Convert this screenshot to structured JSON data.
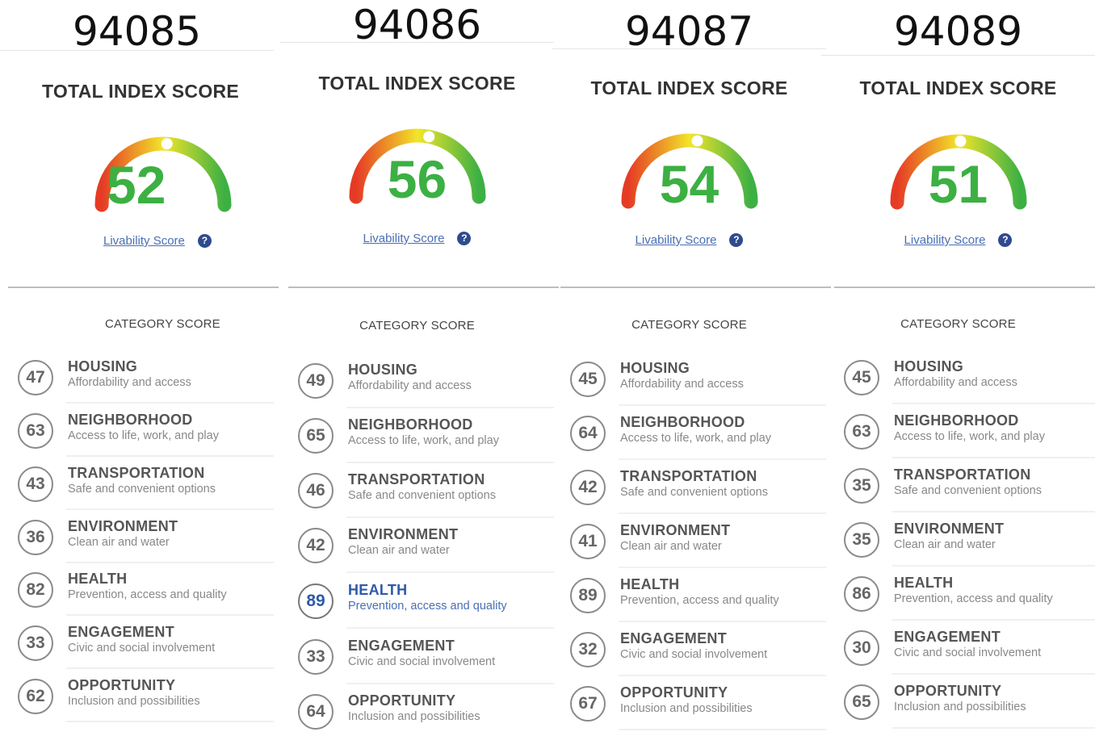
{
  "labels": {
    "total_index_score": "TOTAL INDEX SCORE",
    "livability_link": "Livability Score",
    "help_glyph": "?",
    "category_score": "CATEGORY SCORE"
  },
  "colors": {
    "score_green": "#3cb043",
    "link_blue": "#4a6fb5",
    "help_navy": "#2f4b8f",
    "gauge_red": "#e53b25",
    "gauge_yellow": "#f2e52a",
    "gauge_green": "#3cb043"
  },
  "categories": [
    {
      "name": "HOUSING",
      "desc": "Affordability and access"
    },
    {
      "name": "NEIGHBORHOOD",
      "desc": "Access to life, work, and play"
    },
    {
      "name": "TRANSPORTATION",
      "desc": "Safe and convenient options"
    },
    {
      "name": "ENVIRONMENT",
      "desc": "Clean air and water"
    },
    {
      "name": "HEALTH",
      "desc": "Prevention, access and quality"
    },
    {
      "name": "ENGAGEMENT",
      "desc": "Civic and social involvement"
    },
    {
      "name": "OPPORTUNITY",
      "desc": "Inclusion and possibilities"
    }
  ],
  "panels": [
    {
      "zip": "94085",
      "total_score": "52",
      "scores": [
        "47",
        "63",
        "43",
        "36",
        "82",
        "33",
        "62"
      ]
    },
    {
      "zip": "94086",
      "total_score": "56",
      "scores": [
        "49",
        "65",
        "46",
        "42",
        "89",
        "33",
        "64"
      ]
    },
    {
      "zip": "94087",
      "total_score": "54",
      "scores": [
        "45",
        "64",
        "42",
        "41",
        "89",
        "32",
        "67"
      ]
    },
    {
      "zip": "94089",
      "total_score": "51",
      "scores": [
        "45",
        "63",
        "35",
        "35",
        "86",
        "30",
        "65"
      ]
    }
  ]
}
